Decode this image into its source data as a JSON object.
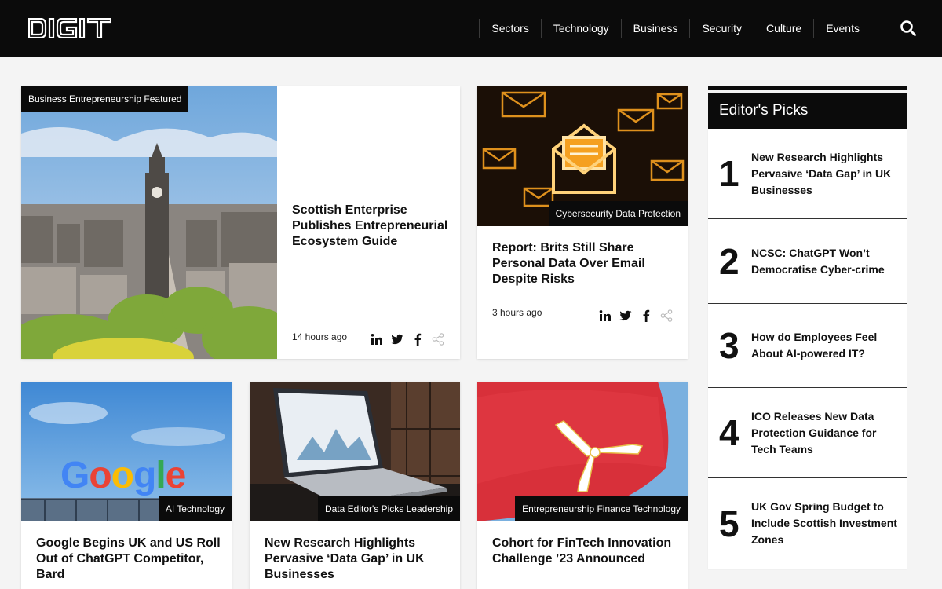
{
  "header": {
    "logo_text": "DIGIT",
    "nav": [
      "Sectors",
      "Technology",
      "Business",
      "Security",
      "Culture",
      "Events"
    ],
    "search_icon": "search-icon"
  },
  "featured": {
    "tag": "Business Entrepreneurship Featured",
    "title": "Scottish Enterprise Publishes Entrepreneurial Ecosystem Guide",
    "time": "14 hours ago"
  },
  "card_email": {
    "tag": "Cybersecurity Data Protection",
    "title": "Report: Brits Still Share Personal Data Over Email Despite Risks",
    "time": "3 hours ago"
  },
  "card_google": {
    "tag": "AI Technology",
    "title": "Google Begins UK and US Roll Out of ChatGPT Competitor, Bard",
    "sign": "Google"
  },
  "card_data": {
    "tag": "Data Editor's Picks Leadership",
    "title": "New Research Highlights Pervasive ‘Data Gap’ in UK Businesses"
  },
  "card_fintech": {
    "tag": "Entrepreneurship Finance Technology",
    "title": "Cohort for FinTech Innovation Challenge ’23 Announced"
  },
  "share_icons": [
    "linkedin-icon",
    "twitter-icon",
    "facebook-icon",
    "share-icon"
  ],
  "editors_picks": {
    "heading": "Editor's Picks",
    "items": [
      {
        "num": "1",
        "title": "New Research Highlights Pervasive ‘Data Gap’ in UK Businesses"
      },
      {
        "num": "2",
        "title": "NCSC: ChatGPT Won’t Democratise Cyber-crime"
      },
      {
        "num": "3",
        "title": "How do Employees Feel About AI-powered IT?"
      },
      {
        "num": "4",
        "title": "ICO Releases New Data Protection Guidance for Tech Teams"
      },
      {
        "num": "5",
        "title": "UK Gov Spring Budget to Include Scottish Investment Zones"
      }
    ]
  },
  "colors": {
    "header_bg": "#0b0b0b",
    "page_bg": "#f4f4f4",
    "flag_red": "#d8303a",
    "email_orange": "#f5a020"
  }
}
